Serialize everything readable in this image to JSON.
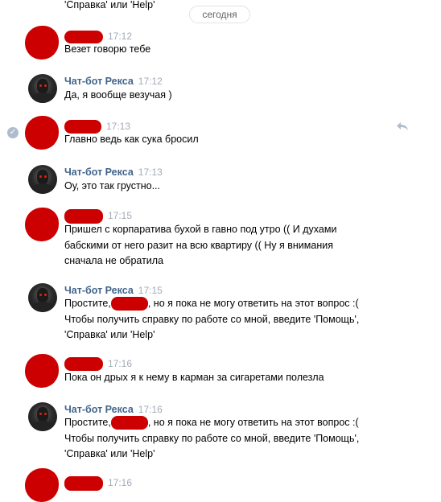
{
  "top_text": "'Справка' или 'Help'",
  "date_label": "сегодня",
  "bot_name": "Чат-бот Рекса",
  "messages": [
    {
      "time": "17:12",
      "text": "Везет говорю тебе"
    },
    {
      "time": "17:12",
      "text": "Да, я вообще везучая )"
    },
    {
      "time": "17:13",
      "text": "Главно ведь как сука бросил"
    },
    {
      "time": "17:13",
      "text": "Оу, это так грустно..."
    },
    {
      "time": "17:15",
      "lines": [
        "Пришел с корпаратива бухой в гавно под утро (( И духами",
        "бабскими от него разит на всю квартиру (( Ну я внимания",
        "сначала не обратила"
      ]
    },
    {
      "time": "17:15",
      "line1_prefix": "Простите,",
      "line1_suffix": ", но я пока не могу ответить на этот вопрос :(",
      "line2": "Чтобы получить справку по работе со мной, введите 'Помощь',",
      "line3": "'Справка' или 'Help'"
    },
    {
      "time": "17:16",
      "text": "Пока он дрых я к нему в карман за сигаретами полезла"
    },
    {
      "time": "17:16",
      "line1_prefix": "Простите,",
      "line1_suffix": ", но я пока не могу ответить на этот вопрос :(",
      "line2": "Чтобы получить справку по работе со мной, введите 'Помощь',",
      "line3": "'Справка' или 'Help'"
    },
    {
      "time": "17:16"
    }
  ],
  "colors": {
    "redaction": "#cc0000",
    "author": "#42648b",
    "time": "#a2abb6"
  }
}
